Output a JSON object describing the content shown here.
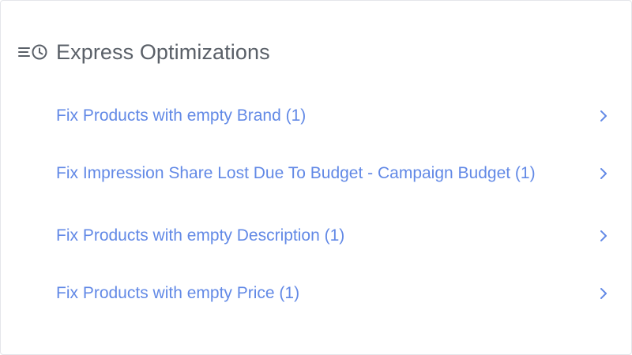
{
  "panel": {
    "title": "Express Optimizations",
    "title_icon": "queue-history-icon",
    "accent_color": "#6289e6",
    "title_color": "#5a6068"
  },
  "optimizations": [
    {
      "label": "Fix Products with empty Brand (1)",
      "icon": "chevron-right-icon"
    },
    {
      "label": "Fix Impression Share Lost Due To Budget - Campaign Budget (1)",
      "icon": "chevron-right-icon"
    },
    {
      "label": "Fix Products with empty Description (1)",
      "icon": "chevron-right-icon"
    },
    {
      "label": "Fix Products with empty Price (1)",
      "icon": "chevron-right-icon"
    }
  ]
}
